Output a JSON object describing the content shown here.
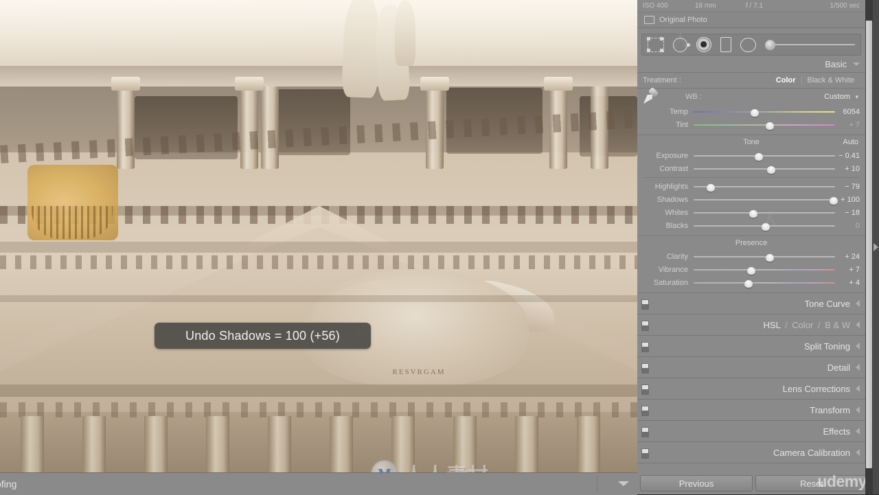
{
  "photo": {
    "relief_inscription": "RESVRGAM",
    "watermark_cn": "人人素材",
    "watermark_cn_mark": "M"
  },
  "toast": {
    "message": "Undo Shadows = 100 (+56)"
  },
  "bottom_bar": {
    "left_text": "ofing",
    "chevron_icon": "chevron-down-icon"
  },
  "right_panel": {
    "metadata": {
      "iso": "ISO 400",
      "focal_length": "18 mm",
      "aperture": "f / 7.1",
      "shutter": "1/500 sec"
    },
    "original_photo": {
      "label": "Original Photo",
      "icon": "rectangle-icon"
    },
    "tools": [
      {
        "name": "crop-overlay-tool",
        "icon": "crop-icon"
      },
      {
        "name": "spot-removal-tool",
        "icon": "spot-removal-icon"
      },
      {
        "name": "red-eye-correction-tool",
        "icon": "red-eye-icon"
      },
      {
        "name": "graduated-filter-tool",
        "icon": "graduated-filter-icon"
      },
      {
        "name": "radial-filter-tool",
        "icon": "radial-filter-icon"
      },
      {
        "name": "adjustment-brush-tool",
        "icon": "brush-icon"
      }
    ],
    "basic": {
      "title": "Basic",
      "treatment": {
        "label": "Treatment :",
        "color": "Color",
        "black_white": "Black & White",
        "selected": "Color"
      },
      "white_balance": {
        "label": "WB :",
        "value": "Custom",
        "eyedropper_icon": "eyedropper-icon",
        "sliders": [
          {
            "label": "Temp",
            "value": "6054",
            "pos": 43
          },
          {
            "label": "Tint",
            "value": "+ 7",
            "pos": 54
          }
        ]
      },
      "tone": {
        "title": "Tone",
        "auto": "Auto",
        "sliders": [
          {
            "label": "Exposure",
            "value": "− 0.41",
            "pos": 46
          },
          {
            "label": "Contrast",
            "value": "+ 10",
            "pos": 55
          },
          {
            "label": "Highlights",
            "value": "− 79",
            "pos": 12
          },
          {
            "label": "Shadows",
            "value": "+ 100",
            "pos": 99
          },
          {
            "label": "Whites",
            "value": "− 18",
            "pos": 42
          },
          {
            "label": "Blacks",
            "value": "0",
            "pos": 51
          }
        ]
      },
      "presence": {
        "title": "Presence",
        "sliders": [
          {
            "label": "Clarity",
            "value": "+ 24",
            "pos": 54
          },
          {
            "label": "Vibrance",
            "value": "+ 7",
            "pos": 41
          },
          {
            "label": "Saturation",
            "value": "+ 4",
            "pos": 39
          }
        ]
      }
    },
    "collapsed_panels": [
      {
        "name": "Tone Curve"
      },
      {
        "name": "HSL",
        "mid1": "Color",
        "mid2": "B & W",
        "split": true
      },
      {
        "name": "Split Toning"
      },
      {
        "name": "Detail"
      },
      {
        "name": "Lens Corrections"
      },
      {
        "name": "Transform"
      },
      {
        "name": "Effects"
      },
      {
        "name": "Camera Calibration"
      }
    ],
    "footer": {
      "previous": "Previous",
      "reset": "Reset"
    },
    "watermark": "udemy"
  }
}
